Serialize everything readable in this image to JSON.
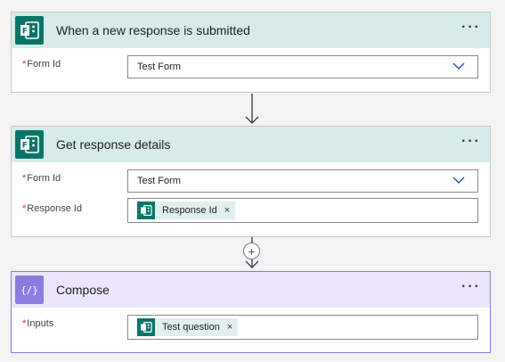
{
  "colors": {
    "forms_accent": "#077568",
    "forms_header": "#d6ecea",
    "compose_accent": "#8c7ce0",
    "compose_header": "#ebe6fb",
    "required": "#c4314b"
  },
  "step1": {
    "title": "When a new response is submitted",
    "icon": "forms-icon",
    "more": "···",
    "form_id_label": "Form Id",
    "form_id_value": "Test Form"
  },
  "step2": {
    "title": "Get response details",
    "icon": "forms-icon",
    "more": "···",
    "form_id_label": "Form Id",
    "form_id_value": "Test Form",
    "response_id_label": "Response Id",
    "response_id_token": "Response Id",
    "token_remove": "×"
  },
  "add_step": "+",
  "step3": {
    "title": "Compose",
    "icon": "compose-icon",
    "more": "···",
    "inputs_label": "Inputs",
    "inputs_token": "Test question",
    "token_remove": "×"
  },
  "required_marker": "*"
}
